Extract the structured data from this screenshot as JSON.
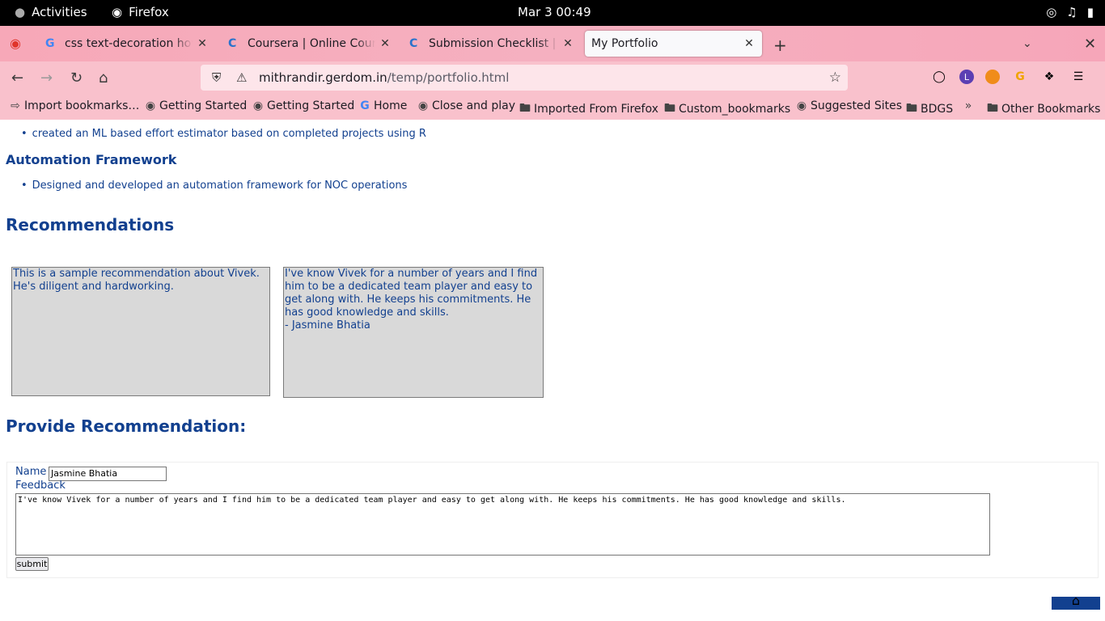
{
  "system": {
    "activities": "Activities",
    "app_name": "Firefox",
    "clock": "Mar 3  00:49"
  },
  "tabs": [
    {
      "title": "css text-decoration how t",
      "active": false
    },
    {
      "title": "Coursera | Online Courses",
      "active": false
    },
    {
      "title": "Submission Checklist | Co",
      "active": false
    },
    {
      "title": "My Portfolio",
      "active": true
    }
  ],
  "navbar": {
    "url_host": "mithrandir.gerdom.in",
    "url_path": "/temp/portfolio.html",
    "profile_letter": "L"
  },
  "bookmarks": [
    {
      "label": "Import bookmarks…",
      "icon": "import-icon"
    },
    {
      "label": "Getting Started",
      "icon": "globe-icon"
    },
    {
      "label": "Getting Started",
      "icon": "globe-icon"
    },
    {
      "label": "Home",
      "icon": "google-icon"
    },
    {
      "label": "Close and play",
      "icon": "globe-icon"
    },
    {
      "label": "Imported From Firefox",
      "icon": "folder-icon"
    },
    {
      "label": "Custom_bookmarks",
      "icon": "folder-icon"
    },
    {
      "label": "Suggested Sites",
      "icon": "globe-icon"
    },
    {
      "label": "BDGS",
      "icon": "folder-icon"
    },
    {
      "label": "Other Bookmarks",
      "icon": "folder-icon"
    }
  ],
  "content": {
    "bullet_ml": "created an ML based effort estimator based on completed projects using R",
    "automation_heading": "Automation Framework",
    "bullet_automation": "Designed and developed an automation framework for NOC operations",
    "recommendations_heading": "Recommendations",
    "rec1": "This is a sample recommendation about Vivek. He's diligent and hardworking.",
    "rec2_text": "I've know Vivek for a number of years and I find him to be a dedicated team player and easy to get along with. He keeps his commitments. He has good knowledge and skills.",
    "rec2_author": "- Jasmine Bhatia",
    "provide_heading": "Provide Recommendation:",
    "name_label": "Name",
    "name_value": "Jasmine Bhatia",
    "feedback_label": "Feedback",
    "feedback_value": "I've know Vivek for a number of years and I find him to be a dedicated team player and easy to get along with. He keeps his commitments. He has good knowledge and skills.",
    "submit_label": "submit"
  },
  "colors": {
    "text_accent": "#12408f",
    "rec_background": "#d9d9d9",
    "tabstrip": "#f7a8b8"
  }
}
